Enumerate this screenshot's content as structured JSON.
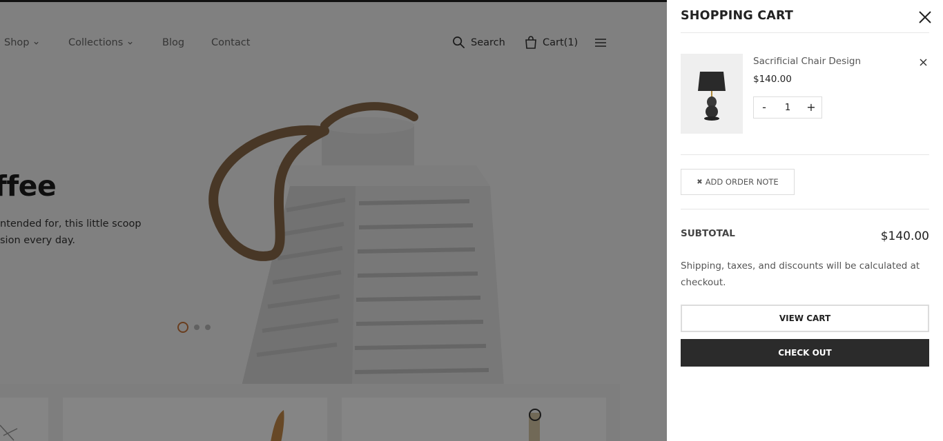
{
  "nav": {
    "items": [
      {
        "label": "Shop"
      },
      {
        "label": "Collections"
      },
      {
        "label": "Blog"
      },
      {
        "label": "Contact"
      }
    ],
    "search_label": "Search",
    "cart_label": "Cart(1)"
  },
  "hero": {
    "title": "ffee",
    "text_line1": "ntended for, this little scoop",
    "text_line2": "sion every day.",
    "slide_count": 3,
    "active_slide": 1
  },
  "cart": {
    "title": "SHOPPING CART",
    "item": {
      "name": "Sacrificial Chair Design",
      "price": "$140.00",
      "quantity": "1",
      "minus_label": "-",
      "plus_label": "+"
    },
    "note_button_icon": "✖",
    "note_button_label": "ADD ORDER NOTE",
    "subtotal_label": "SUBTOTAL",
    "subtotal_value": "$140.00",
    "shipping_note": "Shipping, taxes, and discounts will be calculated at checkout.",
    "view_cart_label": "VIEW CART",
    "checkout_label": "CHECK OUT"
  },
  "colors": {
    "accent_dot": "#c9763a",
    "checkout_bg": "#2b2b2b",
    "overlay": "rgba(0,0,0,0.48)"
  },
  "icons": {
    "search": "search-icon",
    "cart": "shopping-bag-icon",
    "menu": "hamburger-menu-icon",
    "close": "close-icon",
    "remove": "remove-item-icon",
    "chevron": "chevron-down-icon"
  }
}
